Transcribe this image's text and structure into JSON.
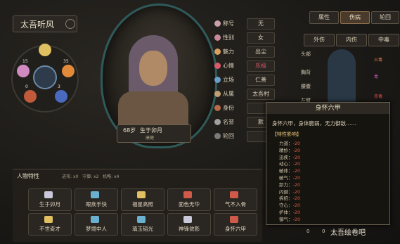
{
  "character": {
    "name": "太吾听风",
    "age": "68岁",
    "birthday": "生于卯月",
    "health": "康健"
  },
  "info": {
    "rows": [
      {
        "label": "称号",
        "value": "无",
        "color": "#c8a0a8"
      },
      {
        "label": "性别",
        "value": "女",
        "color": "#c88a9a"
      },
      {
        "label": "魅力",
        "value": "出尘",
        "color": "#d8a060"
      },
      {
        "label": "心情",
        "value": "乐极",
        "color": "#d85a6a"
      },
      {
        "label": "立场",
        "value": "仁善",
        "color": "#6aa0c8"
      },
      {
        "label": "从属",
        "value": "太吾村",
        "color": "#c0a070"
      },
      {
        "label": "身份",
        "value": "",
        "color": "#b86a4a"
      },
      {
        "label": "名誉",
        "value": "默",
        "color": "#a0a0a0"
      },
      {
        "label": "轮回",
        "value": "",
        "color": "#7a7a7a"
      }
    ]
  },
  "wheel": {
    "values": [
      "15",
      "35",
      "0",
      "3"
    ]
  },
  "tabs": {
    "top": [
      "属性",
      "伤病",
      "轮回"
    ],
    "sub": [
      "外伤",
      "内伤",
      "中毒"
    ]
  },
  "limbs": {
    "labels": [
      "头部",
      "胸背",
      "腰腹",
      "左臂"
    ],
    "right": [
      "火毒",
      "毒",
      "赤毒"
    ]
  },
  "traits": {
    "header": "人物特性",
    "stats": {
      "jinqu_label": "进攻:",
      "jinqu_value": "x0",
      "shoubei_label": "守御:",
      "shoubei_value": "x2",
      "jinqi_label": "机略:",
      "jinqi_value": "x4"
    },
    "items": [
      {
        "name": "生于卯月",
        "color": "#c8c8d8"
      },
      {
        "name": "眼疾手快",
        "color": "#6ab0d0"
      },
      {
        "name": "福星高照",
        "color": "#e0c060"
      },
      {
        "name": "面色无华",
        "color": "#d05a4a"
      },
      {
        "name": "气不入骨",
        "color": "#d05a4a"
      },
      {
        "name": "不世奇才",
        "color": "#e0c060"
      },
      {
        "name": "梦境中人",
        "color": "#6ab0d0"
      },
      {
        "name": "瑱玉韬光",
        "color": "#6ab0d0"
      },
      {
        "name": "神锋敛影",
        "color": "#c8c8d8"
      },
      {
        "name": "身怀六甲",
        "color": "#d05a4a"
      }
    ]
  },
  "tooltip": {
    "title": "身怀六甲",
    "desc": "身怀六甲，身体脆弱，无力御敌……",
    "section": "【特性影响】",
    "effects": [
      {
        "name": "力道",
        "value": "-20"
      },
      {
        "name": "精妙",
        "value": "-20"
      },
      {
        "name": "迅疾",
        "value": "-20"
      },
      {
        "name": "动心",
        "value": "-20"
      },
      {
        "name": "破体",
        "value": "-20"
      },
      {
        "name": "破气",
        "value": "-20"
      },
      {
        "name": "卸力",
        "value": "-20"
      },
      {
        "name": "闪避",
        "value": "-20"
      },
      {
        "name": "拆招",
        "value": "-20"
      },
      {
        "name": "守心",
        "value": "-20"
      },
      {
        "name": "护体",
        "value": "-20"
      },
      {
        "name": "御气",
        "value": "-20"
      }
    ]
  },
  "bottom": {
    "v1": "0",
    "v2": "0"
  },
  "watermark": "太吾绘卷吧"
}
